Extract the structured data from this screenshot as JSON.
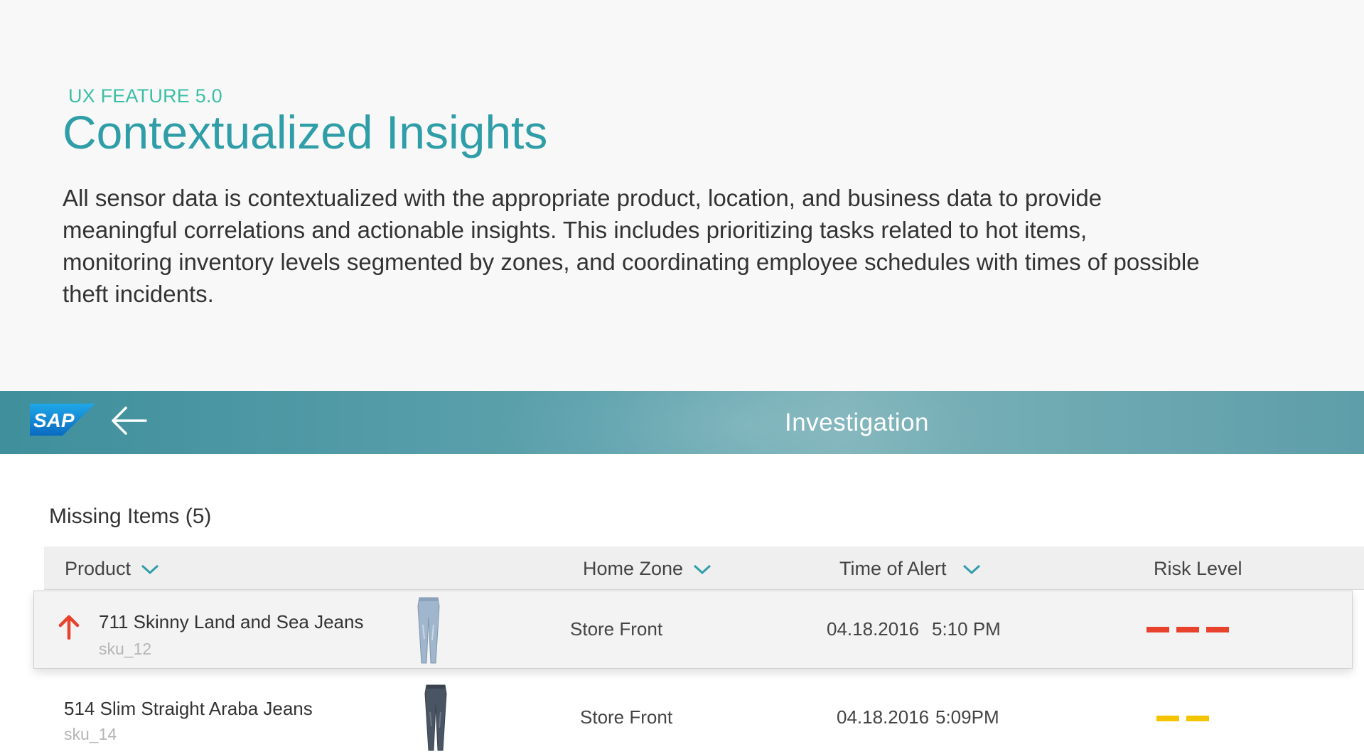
{
  "feature": {
    "label": "UX FEATURE 5.0",
    "title": "Contextualized Insights",
    "description": "All sensor data is contextualized with the appropriate product, location, and business data to provide meaningful correlations and actionable insights. This includes prioritizing tasks related to hot items, monitoring inventory levels segmented by zones, and coordinating employee schedules with times of possible theft incidents."
  },
  "shell": {
    "logo_text": "SAP",
    "title": "Investigation"
  },
  "table": {
    "title": "Missing Items (5)",
    "columns": {
      "product": "Product",
      "home_zone": "Home Zone",
      "time_of_alert": "Time of Alert",
      "risk_level": "Risk Level"
    },
    "rows": [
      {
        "name": "711 Skinny Land and Sea Jeans",
        "sku": "sku_12",
        "zone": "Store Front",
        "date": "04.18.2016",
        "time": "5:10 PM",
        "risk_count": 3,
        "risk_color": "#e8412c",
        "trend_icon": "arrow-up-icon"
      },
      {
        "name": "514 Slim Straight Araba Jeans",
        "sku": "sku_14",
        "zone": "Store Front",
        "date": "04.18.2016",
        "time": "5:09PM",
        "risk_count": 2,
        "risk_color": "#f5c400"
      }
    ]
  },
  "colors": {
    "accent": "#2f9ea8",
    "label": "#3bbfa6",
    "high_risk": "#e8412c",
    "medium_risk": "#f5c400"
  }
}
